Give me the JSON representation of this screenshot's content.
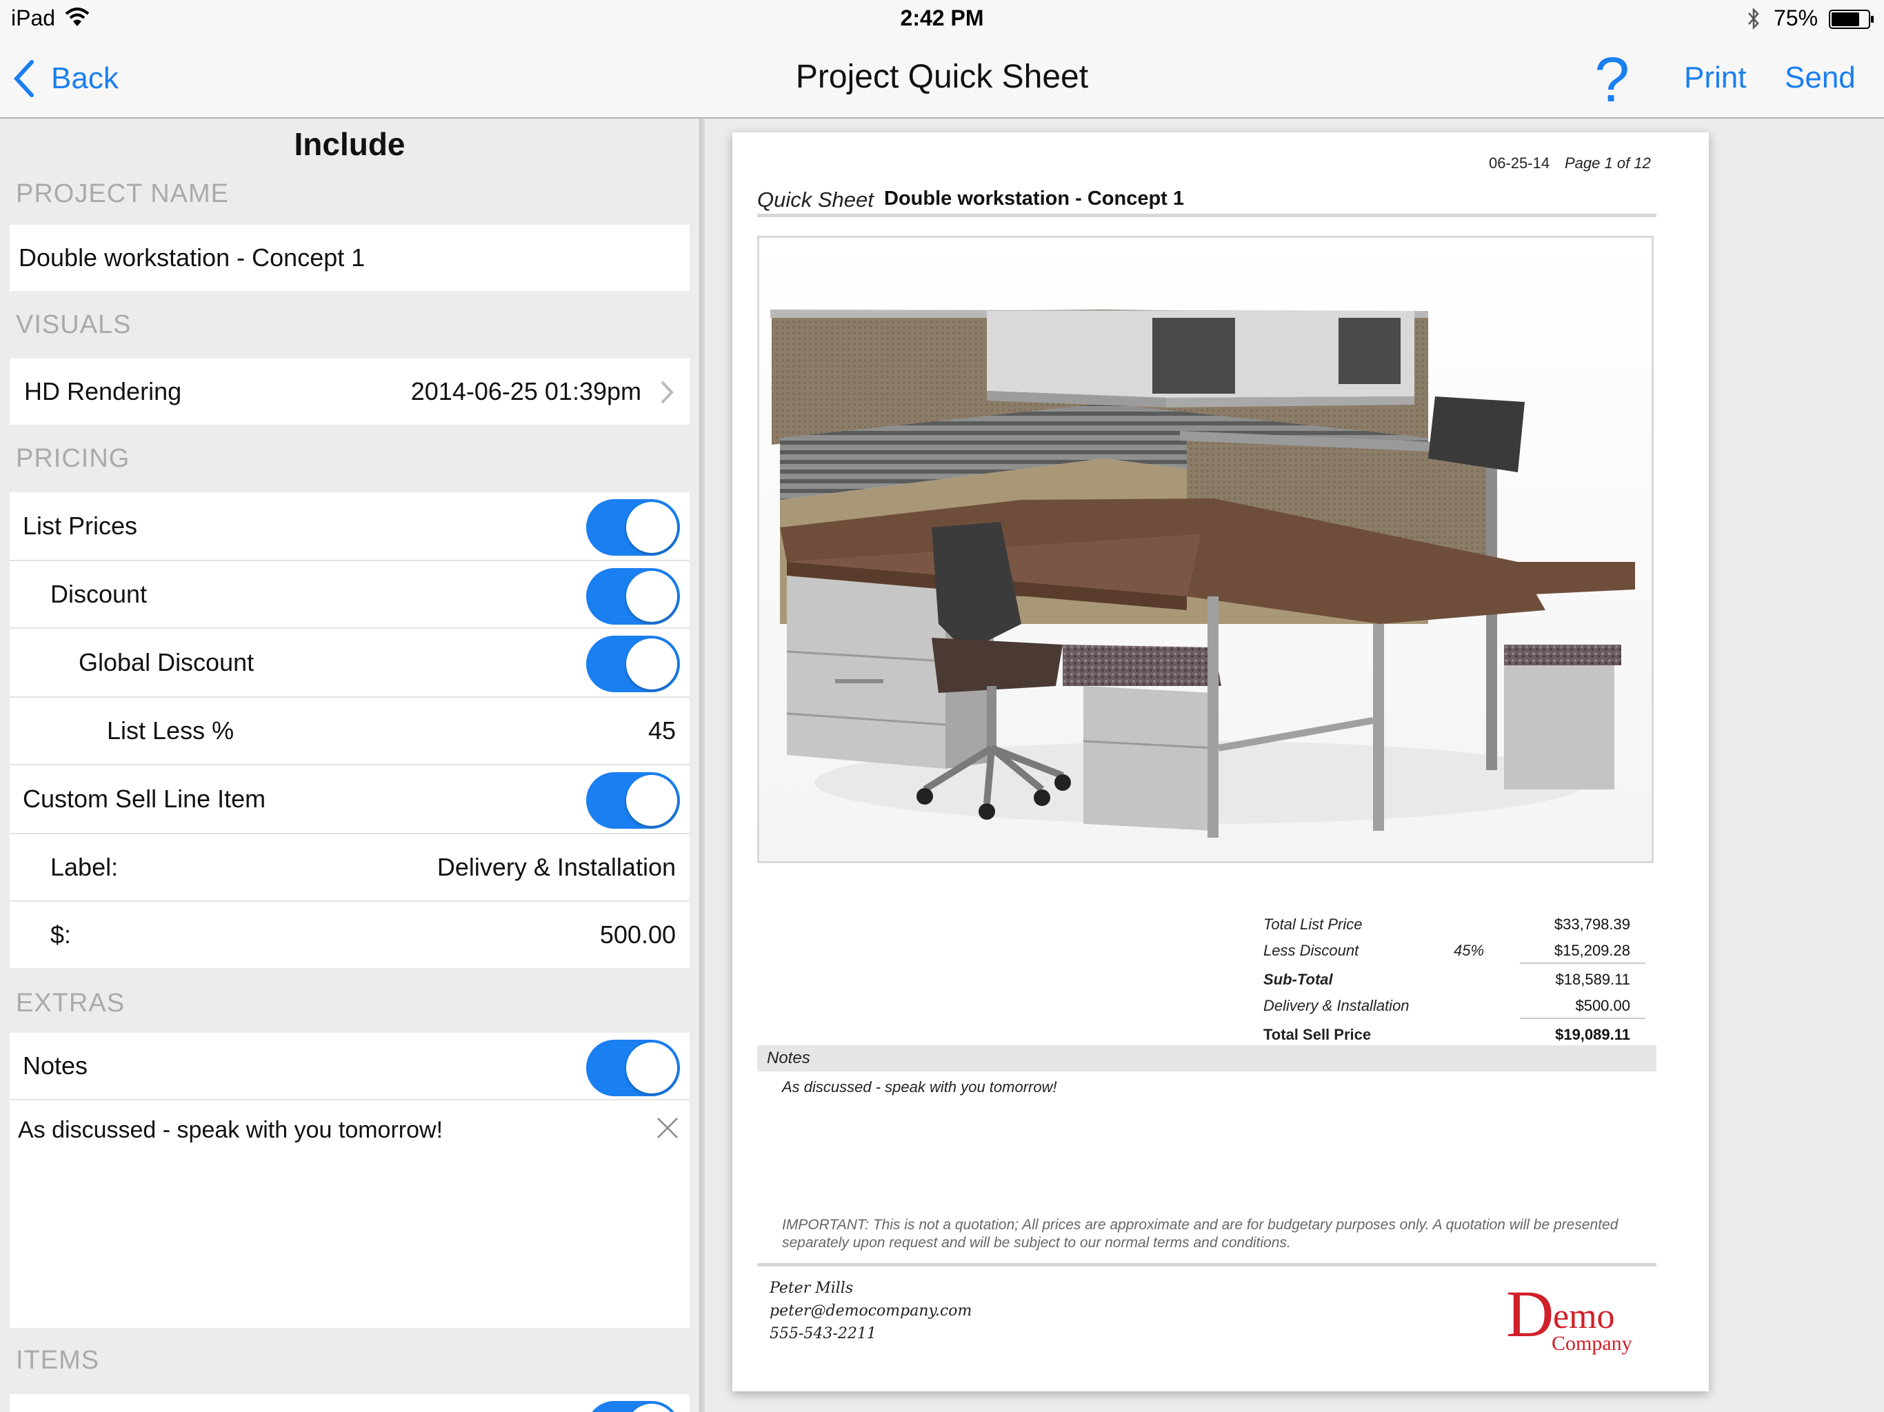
{
  "status_bar": {
    "device": "iPad",
    "time": "2:42 PM",
    "battery": "75%"
  },
  "nav": {
    "back_label": "Back",
    "title": "Project Quick Sheet",
    "help_label": "?",
    "print_label": "Print",
    "send_label": "Send"
  },
  "left_panel": {
    "header": "Include",
    "project_name_section": "PROJECT NAME",
    "project_name_value": "Double workstation - Concept 1",
    "visuals_section": "VISUALS",
    "hd_rendering_label": "HD Rendering",
    "hd_rendering_value": "2014-06-25 01:39pm",
    "pricing_section": "PRICING",
    "list_prices_label": "List Prices",
    "discount_label": "Discount",
    "global_discount_label": "Global Discount",
    "list_less_label": "List Less %",
    "list_less_value": "45",
    "custom_sell_label": "Custom Sell Line Item",
    "label_label": "Label:",
    "label_value": "Delivery & Installation",
    "amount_label": "$:",
    "amount_value": "500.00",
    "extras_section": "EXTRAS",
    "notes_label": "Notes",
    "notes_text": "As discussed - speak with you tomorrow!",
    "items_section": "ITEMS",
    "toggles": {
      "list_prices": true,
      "discount": true,
      "global_discount": true,
      "custom_sell": true,
      "notes": true,
      "items": true
    }
  },
  "preview": {
    "date": "06-25-14",
    "page": "Page 1 of 12",
    "quick_sheet_label": "Quick Sheet",
    "project_name": "Double workstation - Concept 1",
    "totals": {
      "total_list_label": "Total List Price",
      "total_list_value": "$33,798.39",
      "less_discount_label": "Less Discount",
      "less_discount_pct": "45%",
      "less_discount_value": "$15,209.28",
      "subtotal_label": "Sub-Total",
      "subtotal_value": "$18,589.11",
      "delivery_label": "Delivery & Installation",
      "delivery_value": "$500.00",
      "total_sell_label": "Total Sell Price",
      "total_sell_value": "$19,089.11"
    },
    "notes_header": "Notes",
    "notes_text": "As discussed - speak with you tomorrow!",
    "important": "IMPORTANT: This is not a quotation; All prices are approximate and are for budgetary purposes only. A quotation will be presented separately upon request and will be subject to our normal terms and conditions.",
    "contact": {
      "name": "Peter Mills",
      "email": "peter@democompany.com",
      "phone": "555-543-2211"
    },
    "logo": {
      "initial": "D",
      "rest": "emo",
      "sub": "Company"
    }
  },
  "colors": {
    "accent": "#1a7ff0",
    "logo_red": "#d0202a"
  }
}
